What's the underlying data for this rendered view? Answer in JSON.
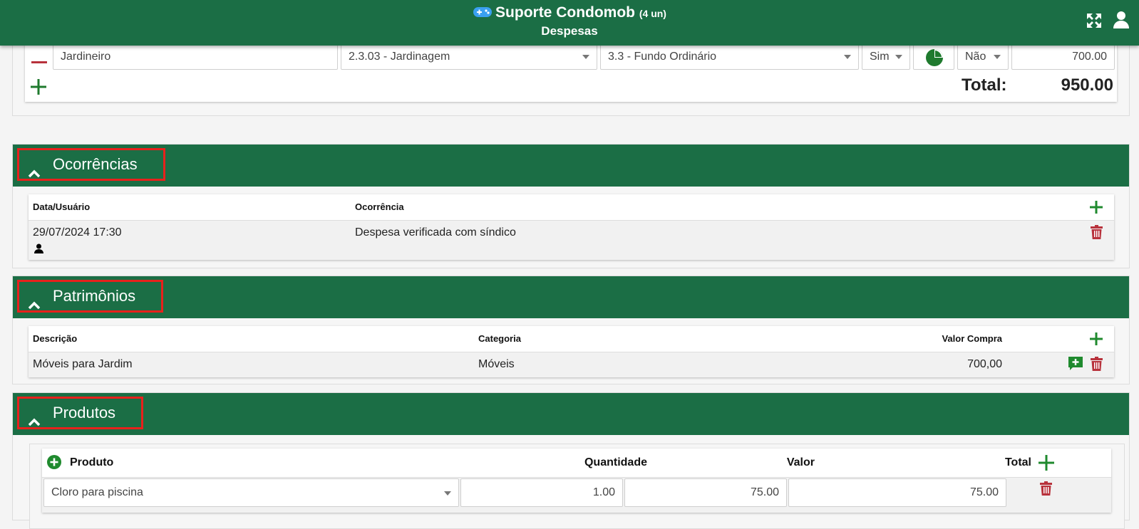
{
  "header": {
    "app_name": "Suporte Condomob",
    "units": "(4 un)",
    "page": "Despesas",
    "icons": [
      "gamepad-icon",
      "expand-icon",
      "user-icon"
    ],
    "color": "#1b6e45"
  },
  "expense_item": {
    "description": "Jardineiro",
    "category": "2.3.03 - Jardinagem",
    "fund": "3.3 - Fundo Ordinário",
    "option1": "Sim",
    "option2": "Não",
    "value": "700.00",
    "total_label": "Total:",
    "total_value": "950.00"
  },
  "ocorrencias": {
    "title": "Ocorrências",
    "columns": [
      "Data/Usuário",
      "Ocorrência"
    ],
    "rows": [
      {
        "date": "29/07/2024 17:30",
        "text": "Despesa verificada com síndico"
      }
    ]
  },
  "patrimonios": {
    "title": "Patrimônios",
    "columns": [
      "Descrição",
      "Categoria",
      "Valor Compra"
    ],
    "rows": [
      {
        "description": "Móveis para Jardim",
        "category": "Móveis",
        "value": "700,00"
      }
    ]
  },
  "produtos": {
    "title": "Produtos",
    "columns": [
      "Produto",
      "Quantidade",
      "Valor",
      "Total"
    ],
    "rows": [
      {
        "product": "Cloro para piscina",
        "quantity": "1.00",
        "value": "75.00",
        "total": "75.00"
      }
    ]
  },
  "colors": {
    "green": "#1b6e45",
    "accent_green": "#1f8a2e",
    "delete_red": "#b8323c",
    "highlight_red": "#e8211c"
  }
}
